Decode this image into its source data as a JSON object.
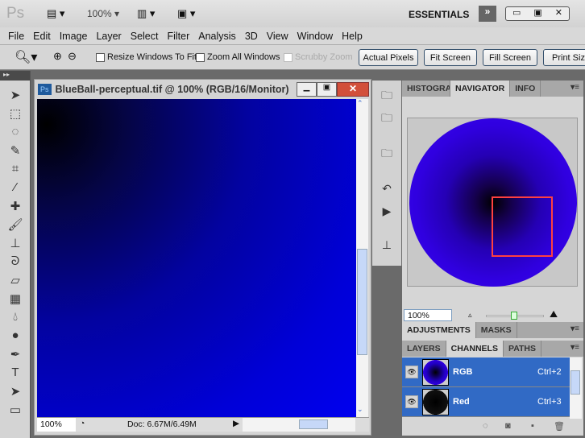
{
  "app": {
    "logo": "Ps",
    "zoom": "100%",
    "workspace": "ESSENTIALS"
  },
  "menu": [
    "File",
    "Edit",
    "Image",
    "Layer",
    "Select",
    "Filter",
    "Analysis",
    "3D",
    "View",
    "Window",
    "Help"
  ],
  "options": {
    "resize_windows": "Resize Windows To Fit",
    "zoom_all": "Zoom All Windows",
    "scrubby": "Scrubby Zoom",
    "actual_pixels": "Actual Pixels",
    "fit_screen": "Fit Screen",
    "fill_screen": "Fill Screen",
    "print_size": "Print Size"
  },
  "document": {
    "title": "BlueBall-perceptual.tif @ 100% (RGB/16/Monitor)",
    "zoom": "100%",
    "doc_size": "Doc: 6.67M/6.49M"
  },
  "panels": {
    "top_tabs": [
      "HISTOGRAM",
      "NAVIGATOR",
      "INFO"
    ],
    "nav_zoom": "100%",
    "mid_tabs": [
      "ADJUSTMENTS",
      "MASKS"
    ],
    "bottom_tabs": [
      "LAYERS",
      "CHANNELS",
      "PATHS"
    ],
    "channels": [
      {
        "name": "RGB",
        "shortcut": "Ctrl+2"
      },
      {
        "name": "Red",
        "shortcut": "Ctrl+3"
      }
    ]
  },
  "colors": {
    "selection": "#316ac5",
    "view_box": "#ff4040",
    "canvas_blue": "#0000f4"
  }
}
